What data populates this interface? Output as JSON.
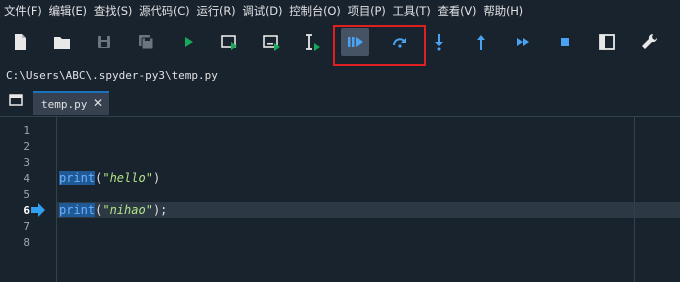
{
  "menu": [
    "文件(F)",
    "编辑(E)",
    "查找(S)",
    "源代码(C)",
    "运行(R)",
    "调试(D)",
    "控制台(O)",
    "项目(P)",
    "工具(T)",
    "查看(V)",
    "帮助(H)"
  ],
  "toolbar": {
    "icons": [
      "new-file-icon",
      "open-folder-icon",
      "save-icon",
      "save-all-icon",
      "run-icon",
      "run-cell-icon",
      "run-cell-advance-icon",
      "run-selection-icon",
      "debug-icon",
      "step-over-icon",
      "step-into-icon",
      "step-return-icon",
      "continue-icon",
      "stop-icon",
      "maximize-pane-icon",
      "preferences-icon"
    ]
  },
  "path": "C:\\Users\\ABC\\.spyder-py3\\temp.py",
  "tab": {
    "label": "temp.py",
    "close": "✕"
  },
  "editor": {
    "line_numbers": [
      "1",
      "2",
      "3",
      "4",
      "5",
      "6",
      "7",
      "8"
    ],
    "current_line": "6",
    "lines": {
      "l4_fn": "print",
      "l4_open": "(",
      "l4_str": "\"hello\"",
      "l4_close": ")",
      "l6_fn": "print",
      "l6_open": "(",
      "l6_str": "\"nihao\"",
      "l6_close": ");"
    }
  },
  "colors": {
    "background": "#19232d",
    "accent": "#1a72bb",
    "highlight_box": "#e02020",
    "string": "#b0e686",
    "function": "#6ab0ff"
  }
}
